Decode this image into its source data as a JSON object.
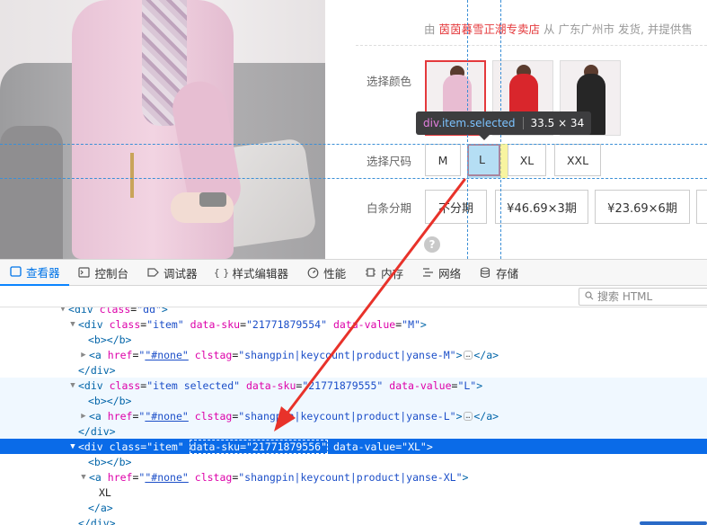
{
  "product": {
    "seller_prefix": "由",
    "seller_shop": "茵茵暮雪正潮专卖店",
    "seller_suffix": "从 广东广州市 发货, 并提供售",
    "color_label": "选择颜色",
    "size_label": "选择尺码",
    "sizes": [
      "M",
      "L",
      "XL",
      "XXL"
    ],
    "installment_label": "白条分期",
    "installments": [
      "不分期",
      "¥46.69×3期",
      "¥23.69×6期"
    ],
    "help_icon": "?"
  },
  "inspector_tooltip": {
    "tag": "div",
    "classes": ".item.selected",
    "size": "33.5 × 34"
  },
  "devtools": {
    "tabs": [
      {
        "icon": "inspector-icon",
        "label": "查看器"
      },
      {
        "icon": "console-icon",
        "label": "控制台"
      },
      {
        "icon": "debugger-icon",
        "label": "调试器"
      },
      {
        "icon": "style-editor-icon",
        "label": "样式编辑器"
      },
      {
        "icon": "performance-icon",
        "label": "性能"
      },
      {
        "icon": "memory-icon",
        "label": "内存"
      },
      {
        "icon": "network-icon",
        "label": "网络"
      },
      {
        "icon": "storage-icon",
        "label": "存储"
      }
    ],
    "search_placeholder": "搜索 HTML"
  },
  "markup": {
    "l0": {
      "tag": "div",
      "attr": "class",
      "val": "\"dd\""
    },
    "l1": {
      "attr1": "class",
      "val1": "\"item\"",
      "attr2": "data-sku",
      "val2": "\"21771879554\"",
      "attr3": "data-value",
      "val3": "\"M\""
    },
    "l2": "<b></b>",
    "l3": {
      "href": "\"#none\"",
      "clstag": "\"shangpin|keycount|product|yanse-M\""
    },
    "l4": "</div>",
    "l5": {
      "attr1": "class",
      "val1": "\"item selected\"",
      "attr2": "data-sku",
      "val2": "\"21771879555\"",
      "attr3": "data-value",
      "val3": "\"L\""
    },
    "l6": "<b></b>",
    "l7": {
      "href": "\"#none\"",
      "clstag": "\"shangpin|keycount|product|yanse-L\""
    },
    "l8": "</div>",
    "l9": {
      "attr1": "class",
      "val1": "\"item\"",
      "attr2": "data-sku",
      "val2": "\"21771879556\"",
      "attr3": "data-value",
      "val3": "\"XL\""
    },
    "l10": "<b></b>",
    "l11": {
      "href": "\"#none\"",
      "clstag": "\"shangpin|keycount|product|yanse-XL\""
    },
    "l12": "XL",
    "l13": "</a>",
    "l14": "</div>"
  },
  "colors": {
    "accent_red": "#e4393c",
    "devtools_blue": "#0a6be8",
    "arrow_red": "#e8322a"
  }
}
